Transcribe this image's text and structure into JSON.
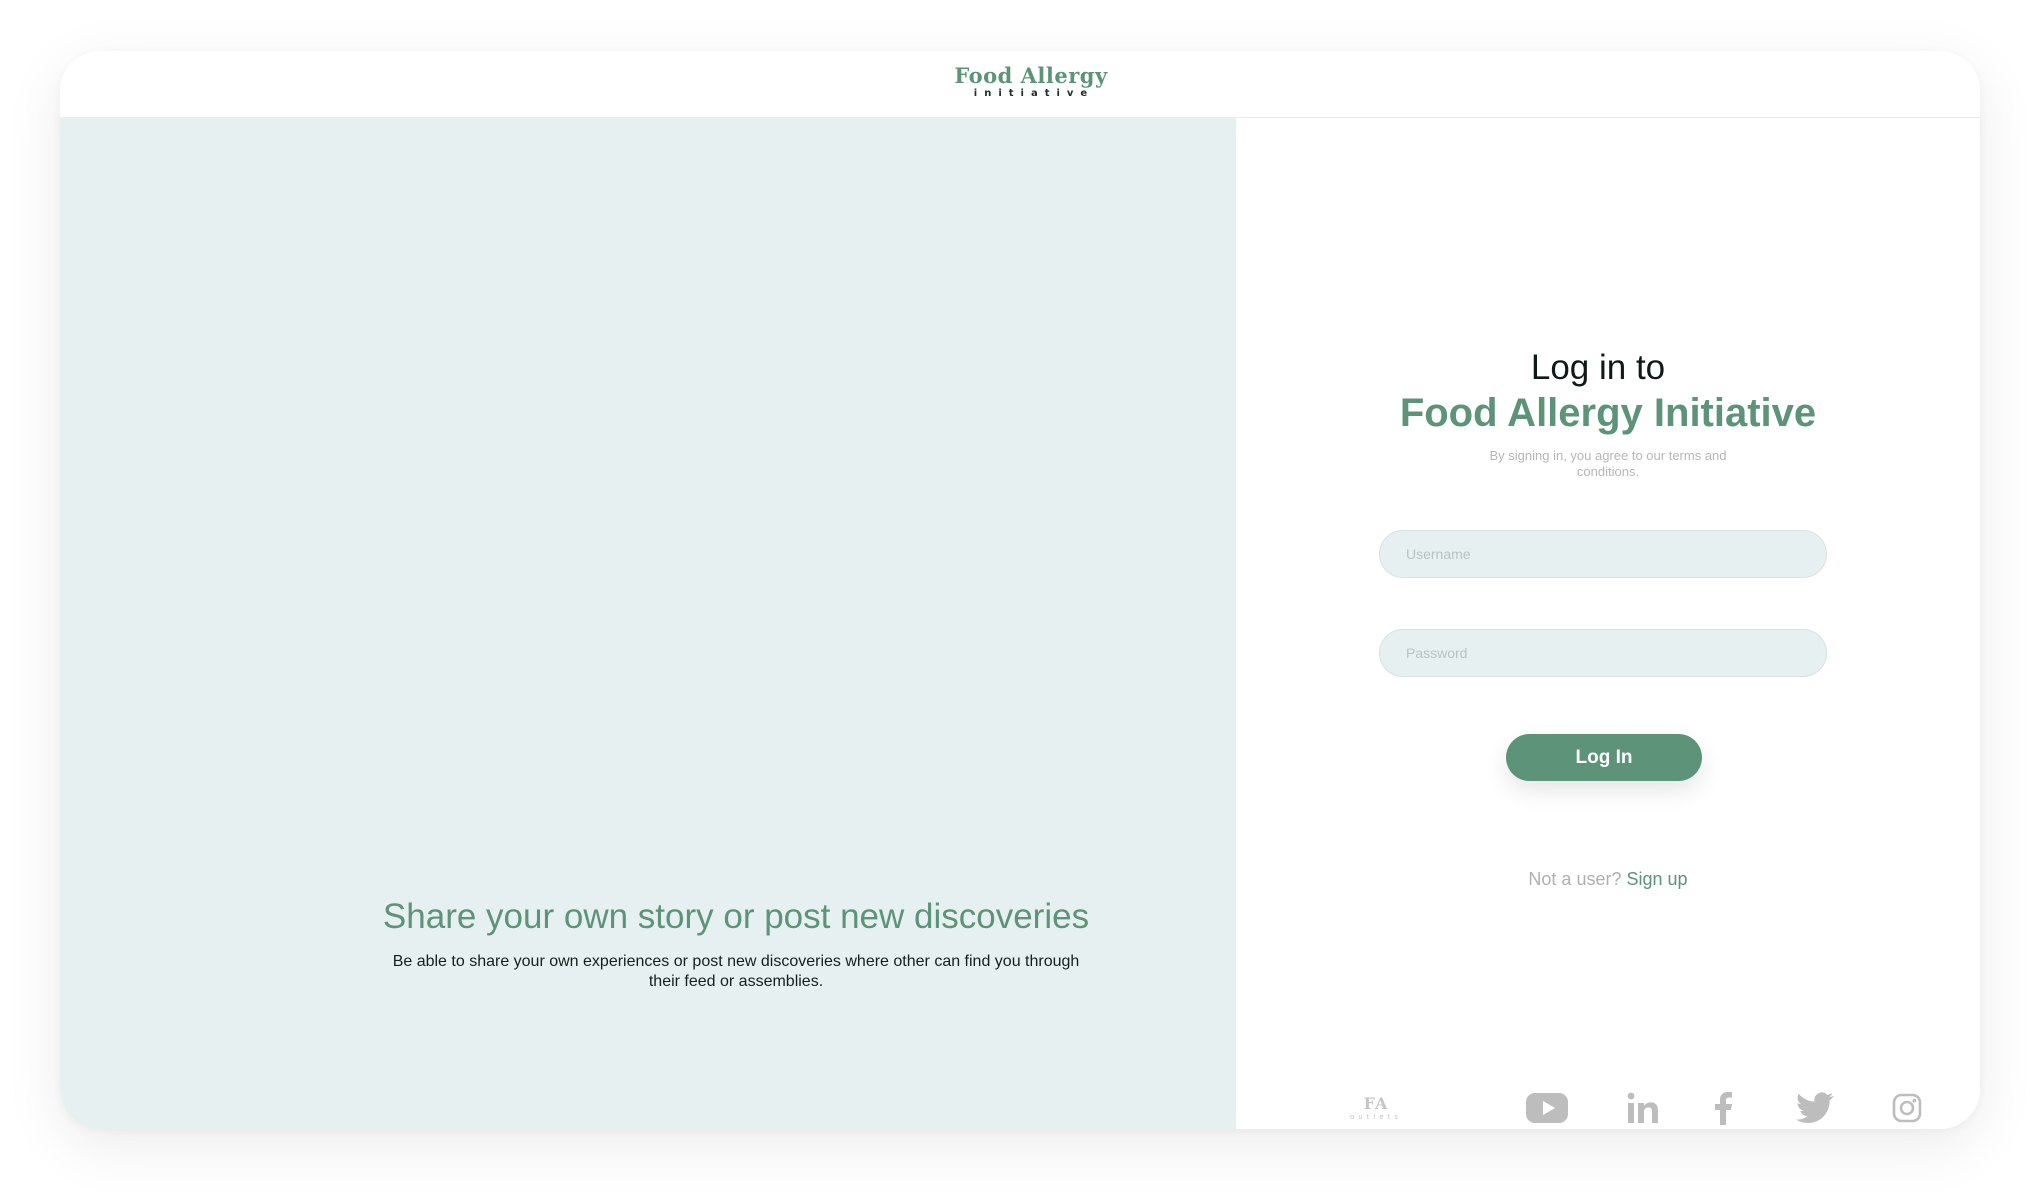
{
  "header": {
    "logo_main": "Food Allergy",
    "logo_sub": "initiative"
  },
  "left": {
    "title": "Share your own story or post new discoveries",
    "description": "Be able to share your own experiences or post new discoveries where other can find you through their feed or assemblies."
  },
  "login": {
    "title_line1": "Log in to",
    "title_line2": "Food Allergy Initiative",
    "terms": "By signing in, you agree to our terms and conditions.",
    "username_placeholder": "Username",
    "password_placeholder": "Password",
    "button_label": "Log In",
    "signup_prompt": "Not a user?",
    "signup_link": "Sign up"
  },
  "social": {
    "fa_main": "FA",
    "fa_sub": "outlets",
    "icons": [
      "fa-outlets-logo",
      "youtube-icon",
      "linkedin-icon",
      "facebook-icon",
      "twitter-icon",
      "instagram-icon"
    ]
  },
  "colors": {
    "brand": "#5c9379",
    "panel_bg": "#e7f0f0",
    "muted": "#bdbdbd"
  }
}
